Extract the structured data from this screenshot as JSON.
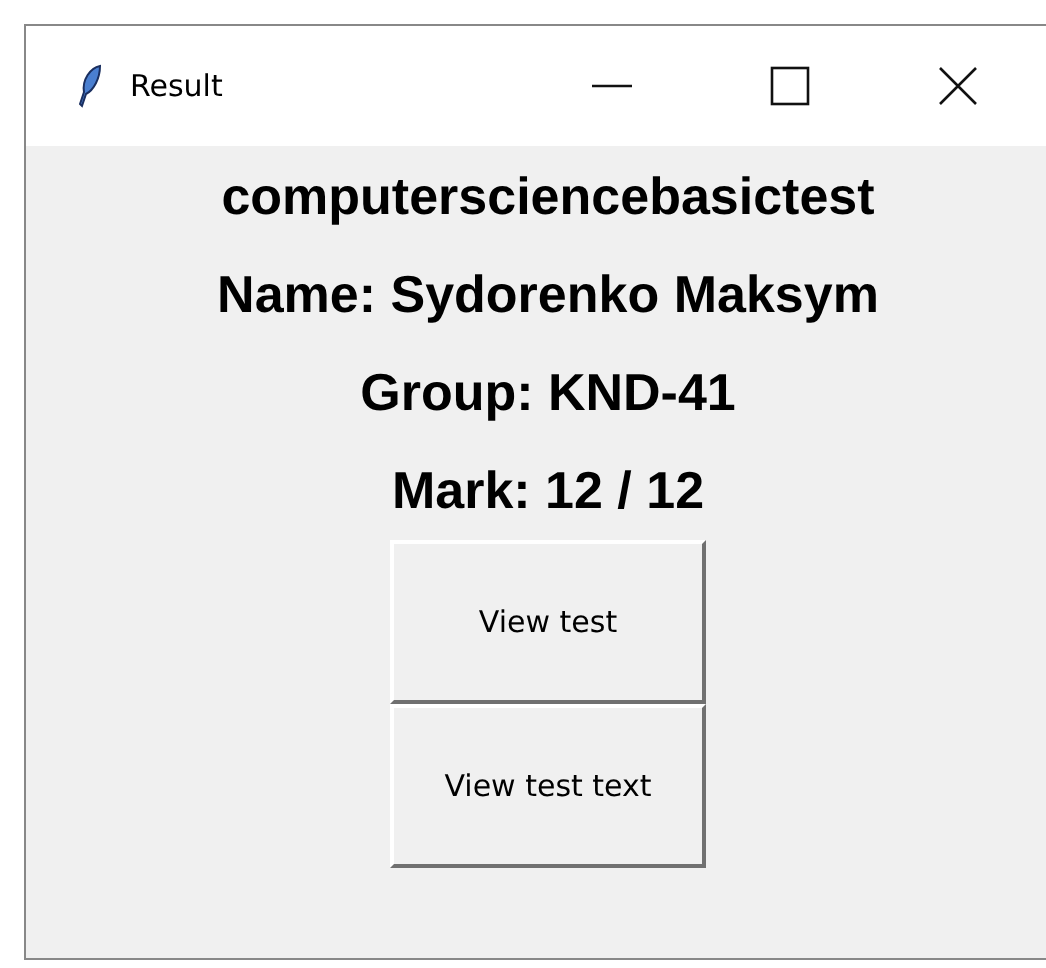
{
  "window": {
    "title": "Result"
  },
  "labels": [
    "computersciencebasictest",
    "Name: Sydorenko Maksym",
    "Group: KND-41",
    "Mark: 12 / 12"
  ],
  "buttons": [
    "View test",
    "View test text"
  ]
}
